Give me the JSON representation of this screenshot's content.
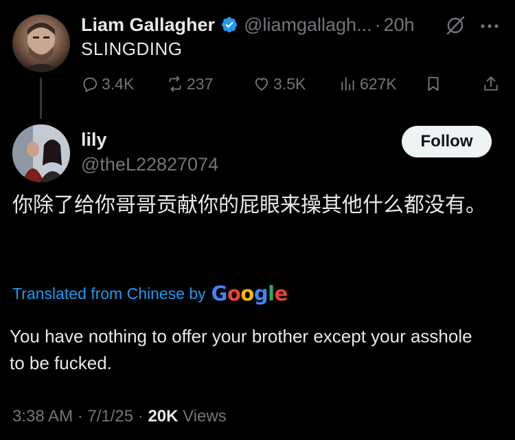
{
  "parent": {
    "display_name": "Liam Gallagher",
    "handle": "@liamgallagh...",
    "separator": "·",
    "time": "20h",
    "text": "SLINGDING",
    "stats": {
      "replies": "3.4K",
      "reposts": "237",
      "likes": "3.5K",
      "views": "627K"
    },
    "icons": [
      "verified-icon",
      "grok-icon",
      "more-icon",
      "reply-icon",
      "repost-icon",
      "like-icon",
      "views-icon",
      "bookmark-icon",
      "share-icon"
    ]
  },
  "reply": {
    "display_name": "lily",
    "handle": "@theL22827074",
    "follow_label": "Follow",
    "text": "你除了给你哥哥贡献你的屁眼来操其他什么都没有。",
    "translated_prefix": "Translated from Chinese by",
    "google": [
      "G",
      "o",
      "o",
      "g",
      "l",
      "e"
    ],
    "translation": "You have nothing to offer your brother except your asshole to be fucked.",
    "timestamp": "3:38 AM · 7/1/25 · ",
    "views_count": "20K",
    "views_label": " Views"
  },
  "colors": {
    "background": "#000000",
    "text": "#e7e9ea",
    "secondary": "#71767b",
    "link": "#1d9bf0",
    "verified": "#1d9bf0",
    "google_blue": "#4285f4",
    "google_red": "#ea4335",
    "google_yellow": "#fbbc05",
    "google_green": "#34a853"
  }
}
